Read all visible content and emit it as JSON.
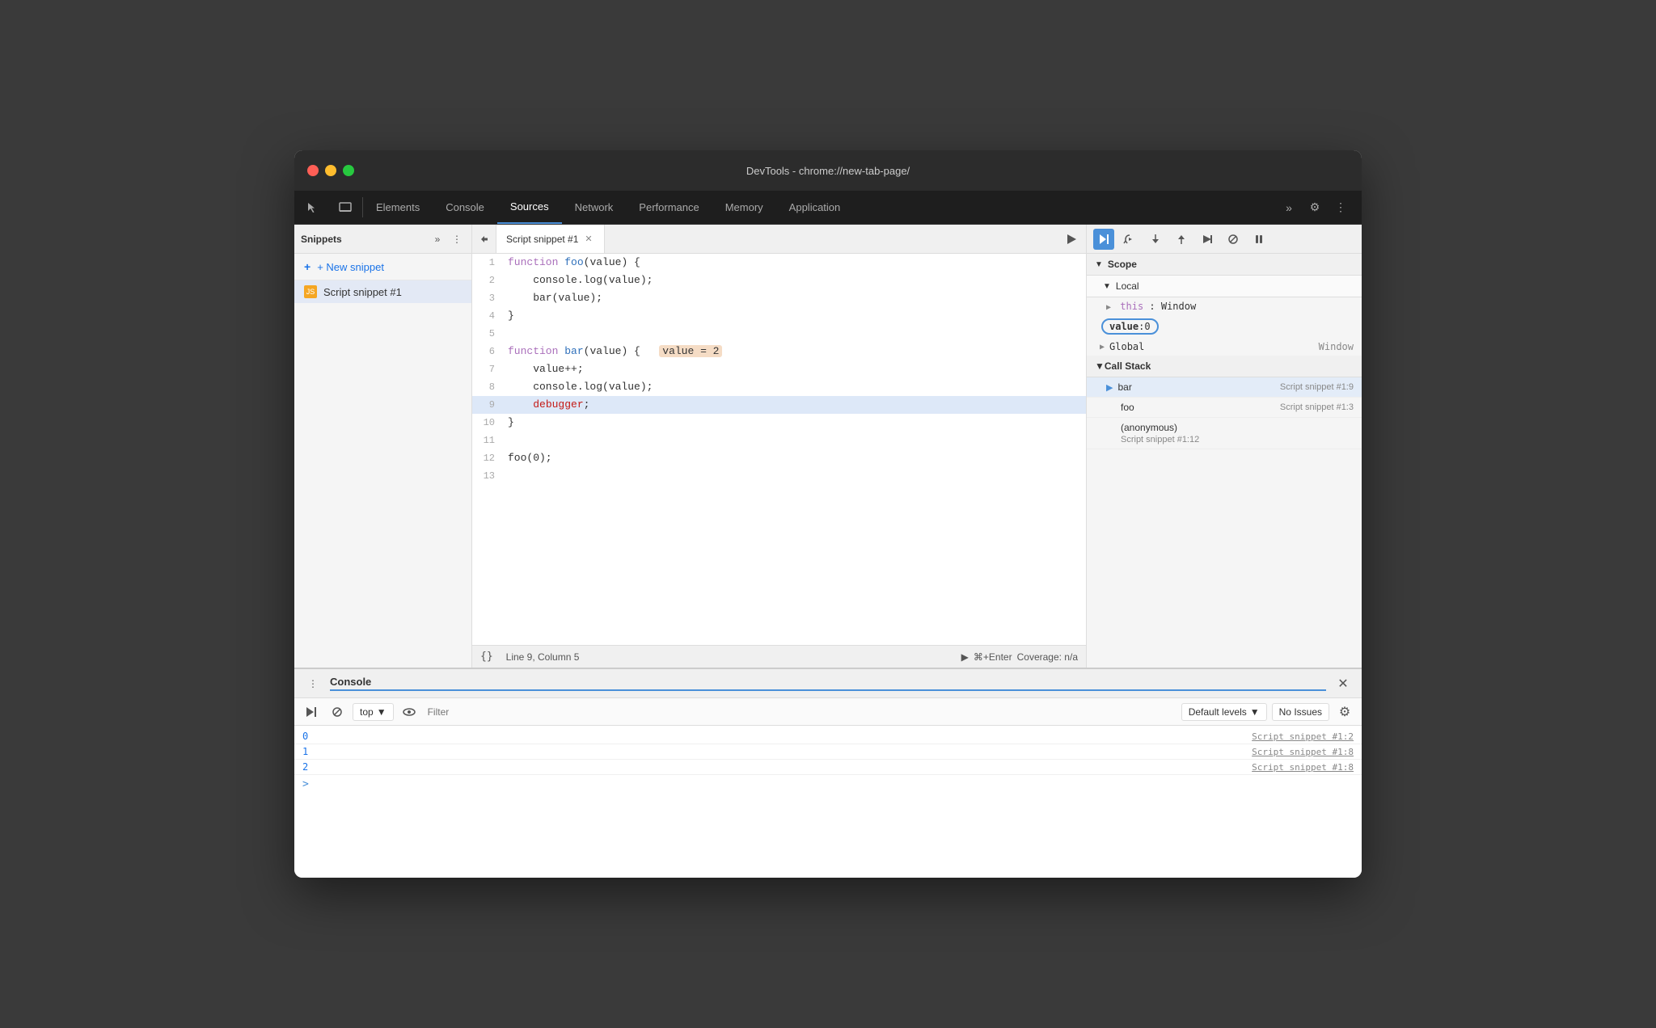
{
  "window": {
    "title": "DevTools - chrome://new-tab-page/"
  },
  "tabs": [
    {
      "label": "Elements",
      "active": false
    },
    {
      "label": "Console",
      "active": false
    },
    {
      "label": "Sources",
      "active": true
    },
    {
      "label": "Network",
      "active": false
    },
    {
      "label": "Performance",
      "active": false
    },
    {
      "label": "Memory",
      "active": false
    },
    {
      "label": "Application",
      "active": false
    }
  ],
  "sidebar": {
    "label": "Snippets",
    "new_snippet": "+ New snippet",
    "snippet_name": "Script snippet #1"
  },
  "editor": {
    "tab_name": "Script snippet #1",
    "status_line": "Line 9, Column 5",
    "run_shortcut": "⌘+Enter",
    "run_label": "Coverage: n/a",
    "lines": [
      {
        "num": "1",
        "content": "function foo(value) {",
        "debugger": false
      },
      {
        "num": "2",
        "content": "    console.log(value);",
        "debugger": false
      },
      {
        "num": "3",
        "content": "    bar(value);",
        "debugger": false
      },
      {
        "num": "4",
        "content": "}",
        "debugger": false
      },
      {
        "num": "5",
        "content": "",
        "debugger": false
      },
      {
        "num": "6",
        "content": "function bar(value) {  value = 2 ",
        "debugger": false,
        "has_inline": true,
        "inline_text": "value = 2"
      },
      {
        "num": "7",
        "content": "    value++;",
        "debugger": false
      },
      {
        "num": "8",
        "content": "    console.log(value);",
        "debugger": false
      },
      {
        "num": "9",
        "content": "    debugger;",
        "debugger": true
      },
      {
        "num": "10",
        "content": "}",
        "debugger": false
      },
      {
        "num": "11",
        "content": "",
        "debugger": false
      },
      {
        "num": "12",
        "content": "foo(0);",
        "debugger": false
      },
      {
        "num": "13",
        "content": "",
        "debugger": false
      }
    ]
  },
  "scope": {
    "title": "Scope",
    "local_label": "Local",
    "this_key": "this",
    "this_val": "Window",
    "value_key": "value",
    "value_val": "0",
    "global_label": "Global",
    "global_val": "Window"
  },
  "callstack": {
    "title": "Call Stack",
    "items": [
      {
        "name": "bar",
        "file": "Script snippet #1:9",
        "active": true
      },
      {
        "name": "foo",
        "file": "Script snippet #1:3",
        "active": false
      },
      {
        "name": "(anonymous)",
        "file": "Script snippet #1:12",
        "active": false
      }
    ]
  },
  "console": {
    "title": "Console",
    "top_label": "top",
    "filter_placeholder": "Filter",
    "default_levels": "Default levels",
    "no_issues": "No Issues",
    "log_entries": [
      {
        "value": "0",
        "source": "Script snippet #1:2"
      },
      {
        "value": "1",
        "source": "Script snippet #1:8"
      },
      {
        "value": "2",
        "source": "Script snippet #1:8"
      }
    ]
  }
}
